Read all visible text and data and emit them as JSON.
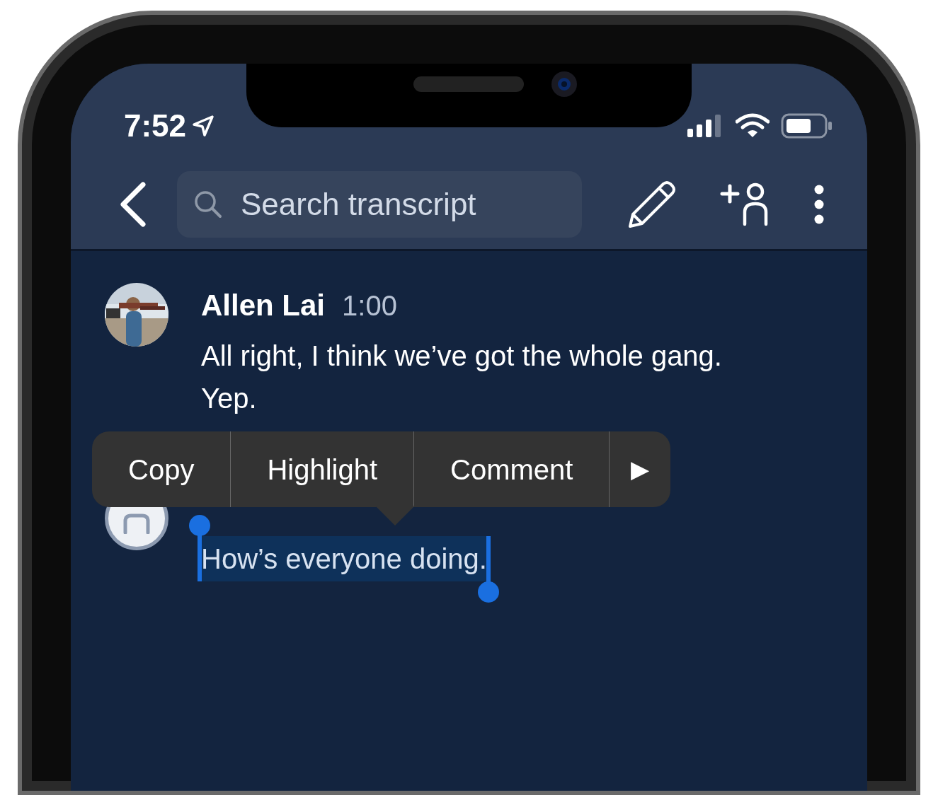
{
  "status_bar": {
    "time": "7:52"
  },
  "header": {
    "search": {
      "placeholder": "Search transcript"
    }
  },
  "transcript": [
    {
      "speaker": "Allen Lai",
      "time": "1:00",
      "text": "All right, I think we’ve got the whole gang. Yep.",
      "selected": false
    },
    {
      "kind": "generic",
      "text": "How’s everyone doing.",
      "selected": true
    }
  ],
  "context_menu": {
    "items": [
      {
        "kind": "text",
        "label": "Copy"
      },
      {
        "kind": "text",
        "label": "Highlight"
      },
      {
        "kind": "text",
        "label": "Comment"
      },
      {
        "kind": "more",
        "label": "▶"
      }
    ]
  }
}
